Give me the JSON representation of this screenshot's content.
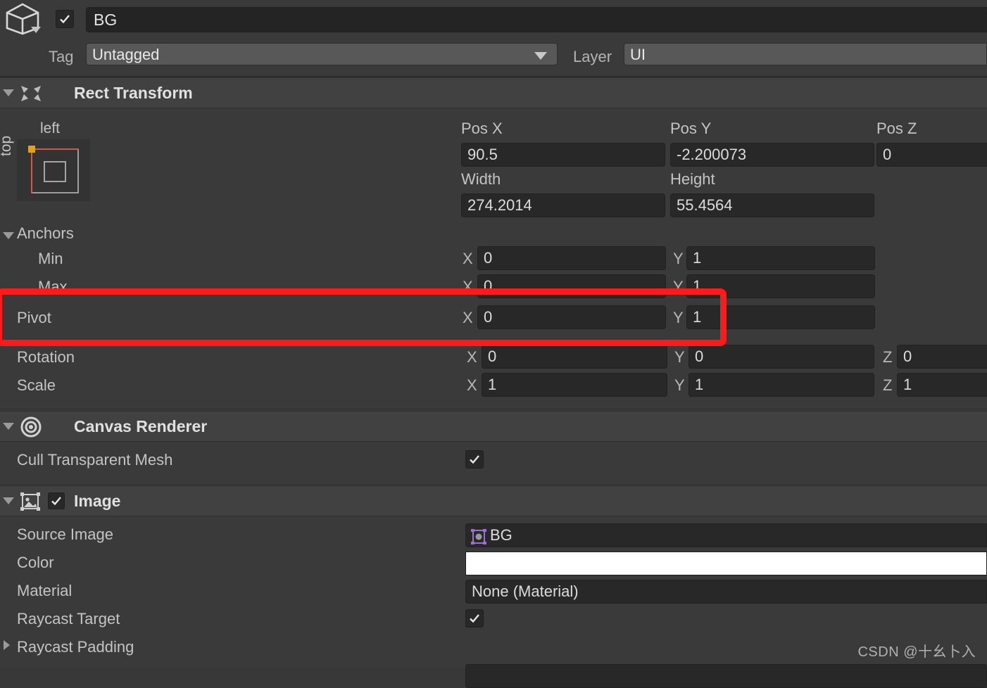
{
  "object_header": {
    "icon": "cube-icon",
    "enabled_checkbox": true,
    "name": "BG",
    "tag_label": "Tag",
    "tag_value": "Untagged",
    "layer_label": "Layer",
    "layer_value": "UI"
  },
  "rect_transform": {
    "title": "Rect Transform",
    "icon": "rect-transform-icon",
    "anchor_preset": {
      "label_horizontal": "left",
      "label_vertical": "top",
      "pivot_color": "#dfa218",
      "anchor_color": "#d4564a"
    },
    "pos": {
      "x_label": "Pos X",
      "x_value": "90.5",
      "y_label": "Pos Y",
      "y_value": "-2.200073",
      "z_label": "Pos Z",
      "z_value": "0"
    },
    "size": {
      "width_label": "Width",
      "width_value": "274.2014",
      "height_label": "Height",
      "height_value": "55.4564"
    },
    "anchors": {
      "title": "Anchors",
      "min_label": "Min",
      "min_x": "0",
      "min_y": "1",
      "max_label": "Max",
      "max_x": "0",
      "max_y": "1"
    },
    "pivot": {
      "label": "Pivot",
      "x": "0",
      "y": "1"
    },
    "rotation": {
      "label": "Rotation",
      "x": "0",
      "y": "0",
      "z": "0"
    },
    "scale": {
      "label": "Scale",
      "x": "1",
      "y": "1",
      "z": "1"
    },
    "axis_x": "X",
    "axis_y": "Y",
    "axis_z": "Z"
  },
  "canvas_renderer": {
    "title": "Canvas Renderer",
    "icon": "canvas-renderer-icon",
    "cull_transparent_mesh_label": "Cull Transparent Mesh",
    "cull_transparent_mesh_checked": true
  },
  "image_component": {
    "title": "Image",
    "icon": "image-component-icon",
    "enabled_checkbox": true,
    "source_image_label": "Source Image",
    "source_image_value": "BG",
    "color_label": "Color",
    "color_value": "#FFFFFF",
    "material_label": "Material",
    "material_value": "None (Material)",
    "raycast_target_label": "Raycast Target",
    "raycast_target_checked": true,
    "raycast_padding_label": "Raycast Padding"
  },
  "annotation": {
    "color": "#fc1b1b",
    "target": "Pivot"
  },
  "watermark": {
    "text": "CSDN @十幺卜入"
  }
}
